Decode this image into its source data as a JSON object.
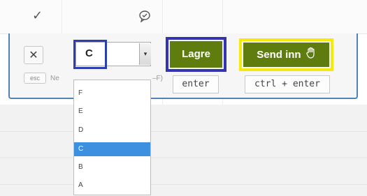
{
  "header": {
    "check_icon": "checkmark-icon",
    "comment_icon": "comment-icon"
  },
  "panel": {
    "close_label": "✕",
    "esc_label": "esc",
    "hint_left": "Ne",
    "hint_right": "–F)"
  },
  "grade_select": {
    "value": "C",
    "arrow": "▾",
    "options": [
      "F",
      "E",
      "D",
      "C",
      "B",
      "A"
    ],
    "selected": "C"
  },
  "save": {
    "label": "Lagre",
    "shortcut": "enter"
  },
  "submit": {
    "label": "Send inn",
    "icon": "hand-icon",
    "shortcut": "ctrl + enter"
  },
  "colors": {
    "panel_border": "#4f83b8",
    "button_green": "#5f7d0f",
    "highlight_blue": "#2b3fb0",
    "highlight_yellow": "#f4ea10",
    "selected_option": "#3d8fe0"
  }
}
